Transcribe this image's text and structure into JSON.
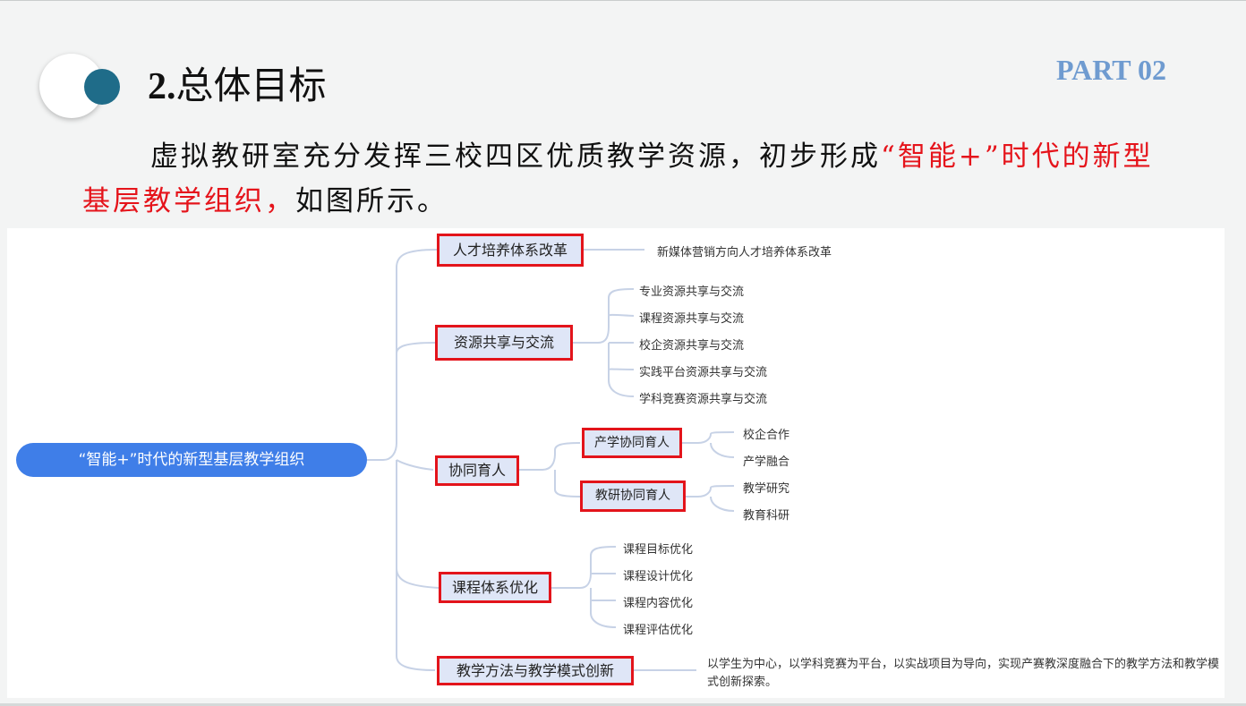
{
  "slide": {
    "title_num": "2.",
    "title_text": "总体目标",
    "part": "PART 02",
    "intro_black1": "虚拟教研室充分发挥三校四区优质教学资源，初步形成",
    "intro_red": "“智能+”时代的新型基层教学组织，",
    "intro_black2": "如图所示。"
  },
  "mindmap": {
    "root": "“智能+”时代的新型基层教学组织",
    "branches": [
      {
        "label": "人才培养体系改革",
        "leaves": [
          "新媒体营销方向人才培养体系改革"
        ]
      },
      {
        "label": "资源共享与交流",
        "leaves": [
          "专业资源共享与交流",
          "课程资源共享与交流",
          "校企资源共享与交流",
          "实践平台资源共享与交流",
          "学科竞赛资源共享与交流"
        ]
      },
      {
        "label": "协同育人",
        "sub": [
          {
            "label": "产学协同育人",
            "leaves": [
              "校企合作",
              "产学融合"
            ]
          },
          {
            "label": "教研协同育人",
            "leaves": [
              "教学研究",
              "教育科研"
            ]
          }
        ]
      },
      {
        "label": "课程体系优化",
        "leaves": [
          "课程目标优化",
          "课程设计优化",
          "课程内容优化",
          "课程评估优化"
        ]
      },
      {
        "label": "教学方法与教学模式创新",
        "leaves": [
          "以学生为中心，以学科竞赛为平台，以实战项目为导向，实现产赛教深度融合下的教学方法和教学模式创新探索。"
        ]
      }
    ]
  },
  "colors": {
    "accent_red": "#e5141b",
    "root_blue": "#3f7ee8",
    "part_blue": "#6f9bd0",
    "dot_teal": "#1f6c89"
  }
}
